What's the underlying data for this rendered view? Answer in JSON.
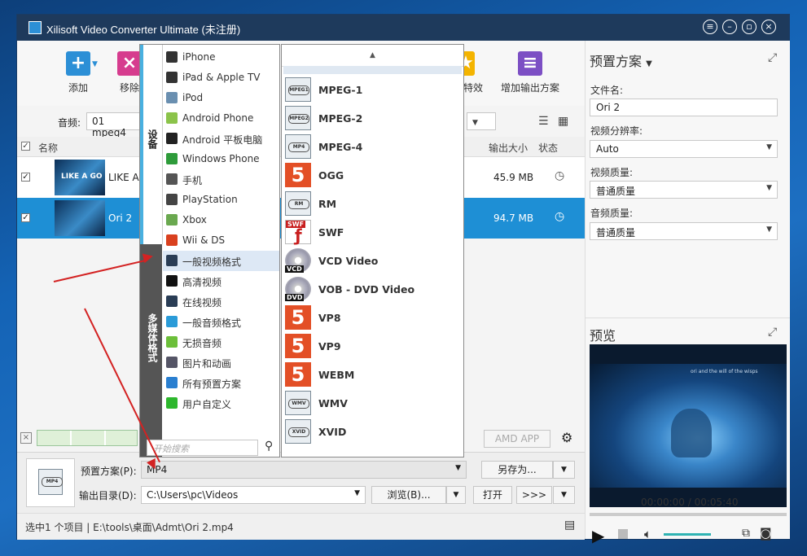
{
  "window": {
    "title": "Xilisoft Video Converter Ultimate (未注册)"
  },
  "toolbar": {
    "add_label": "添加",
    "remove_label": "移除",
    "effects_label": "特效",
    "add_output_label": "增加输出方案"
  },
  "audio": {
    "label": "音频:",
    "value": "01 mpeg4"
  },
  "list": {
    "headers": {
      "name": "名称",
      "output_size": "输出大小",
      "status": "状态"
    },
    "rows": [
      {
        "name": "LIKE A",
        "size": "45.9 MB",
        "thumb_text": "LIKE A GO",
        "checked": true,
        "selected": false
      },
      {
        "name": "Ori 2",
        "size": "94.7 MB",
        "checked": true,
        "selected": true
      }
    ]
  },
  "device_menu": {
    "tab_devices": "设备",
    "tab_multimedia": "多媒体格式",
    "items": [
      {
        "label": "iPhone",
        "icon": "iphone-icon",
        "color": "#333"
      },
      {
        "label": "iPad & Apple TV",
        "icon": "ipad-icon",
        "color": "#333"
      },
      {
        "label": "iPod",
        "icon": "ipod-icon",
        "color": "#6a8fb0"
      },
      {
        "label": "Android Phone",
        "icon": "android-icon",
        "color": "#8bc34a"
      },
      {
        "label": "Android 平板电脑",
        "icon": "android-tablet-icon",
        "color": "#222"
      },
      {
        "label": "Windows Phone",
        "icon": "windows-phone-icon",
        "color": "#2e9b3a"
      },
      {
        "label": "手机",
        "icon": "mobile-phone-icon",
        "color": "#555"
      },
      {
        "label": "PlayStation",
        "icon": "playstation-icon",
        "color": "#444"
      },
      {
        "label": "Xbox",
        "icon": "xbox-icon",
        "color": "#6aa84f"
      },
      {
        "label": "Wii & DS",
        "icon": "wii-ds-icon",
        "color": "#d9401e"
      },
      {
        "label": "一般视频格式",
        "icon": "film-icon",
        "color": "#2a3d55"
      },
      {
        "label": "高清视频",
        "icon": "hd-icon",
        "color": "#111"
      },
      {
        "label": "在线视频",
        "icon": "online-video-icon",
        "color": "#2a3d55"
      },
      {
        "label": "一般音频格式",
        "icon": "music-note-icon",
        "color": "#2a9bd8"
      },
      {
        "label": "无损音频",
        "icon": "lossless-audio-icon",
        "color": "#6cbf3a"
      },
      {
        "label": "图片和动画",
        "icon": "picture-icon",
        "color": "#556"
      },
      {
        "label": "所有预置方案",
        "icon": "play-triangle-icon",
        "color": "#2a7fd0"
      },
      {
        "label": "用户自定义",
        "icon": "user-defined-icon",
        "color": "#2db72d"
      }
    ],
    "search_placeholder": "开始搜索"
  },
  "format_menu": {
    "items": [
      {
        "label": "MPEG-1",
        "type": "film",
        "tag": "MPEG1"
      },
      {
        "label": "MPEG-2",
        "type": "film",
        "tag": "MPEG2"
      },
      {
        "label": "MPEG-4",
        "type": "film",
        "tag": "MP4"
      },
      {
        "label": "OGG",
        "type": "html5",
        "tag": "5"
      },
      {
        "label": "RM",
        "type": "film",
        "tag": "RM"
      },
      {
        "label": "SWF",
        "type": "swf",
        "tag": "SWF"
      },
      {
        "label": "VCD Video",
        "type": "disc",
        "tag": "VCD"
      },
      {
        "label": "VOB - DVD Video",
        "type": "disc",
        "tag": "DVD"
      },
      {
        "label": "VP8",
        "type": "html5",
        "tag": "5"
      },
      {
        "label": "VP9",
        "type": "html5",
        "tag": "5"
      },
      {
        "label": "WEBM",
        "type": "html5",
        "tag": "5"
      },
      {
        "label": "WMV",
        "type": "film",
        "tag": "WMV"
      },
      {
        "label": "XVID",
        "type": "film",
        "tag": "XVID"
      }
    ]
  },
  "bottom": {
    "profile_label": "预置方案(P):",
    "profile_value": "MP4",
    "save_as_label": "另存为...",
    "output_dir_label": "输出目录(D):",
    "output_dir_value": "C:\\Users\\pc\\Videos",
    "browse_label": "浏览(B)...",
    "open_label": "打开",
    "amd_app_label": "AMD APP",
    "convert_label": ">>>",
    "format_tag": "MP4"
  },
  "status": {
    "text": "选中1 个项目 | E:\\tools\\桌面\\Admt\\Ori 2.mp4"
  },
  "preset_panel": {
    "title": "预置方案",
    "filename_label": "文件名:",
    "filename_value": "Ori 2",
    "resolution_label": "视频分辨率:",
    "resolution_value": "Auto",
    "video_quality_label": "视频质量:",
    "video_quality_value": "普通质量",
    "audio_quality_label": "音频质量:",
    "audio_quality_value": "普通质量"
  },
  "preview": {
    "title": "预览",
    "time": "00:00:00 / 00:05:40",
    "video_caption": "ori and the will of the wisps"
  },
  "colors": {
    "accent": "#1e8fd5",
    "selected_row": "#1e8fd5",
    "titlebar": "#1e3a5c",
    "arrow": "#d32222"
  }
}
